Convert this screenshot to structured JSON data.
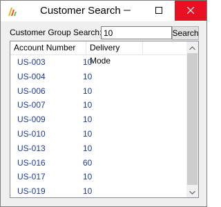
{
  "window": {
    "title": "Customer Search",
    "app_icon": "app-logo-icon",
    "minimize_icon": "minimize-icon",
    "maximize_icon": "maximize-icon",
    "close_icon": "close-icon",
    "close_color": "#e81123"
  },
  "search": {
    "label": "Customer Group Search:",
    "value": "10",
    "button_label": "Search"
  },
  "table": {
    "columns": [
      "Account Number",
      "Delivery Mode"
    ],
    "rows": [
      [
        "US-003",
        "10"
      ],
      [
        "US-004",
        "10"
      ],
      [
        "US-006",
        "10"
      ],
      [
        "US-007",
        "10"
      ],
      [
        "US-009",
        "10"
      ],
      [
        "US-010",
        "10"
      ],
      [
        "US-013",
        "10"
      ],
      [
        "US-016",
        "60"
      ],
      [
        "US-017",
        "10"
      ],
      [
        "US-019",
        "10"
      ]
    ],
    "text_color": "#1f3a93"
  },
  "scrollbar": {
    "up_icon": "scroll-up-arrow-icon",
    "down_icon": "scroll-down-arrow-icon"
  }
}
